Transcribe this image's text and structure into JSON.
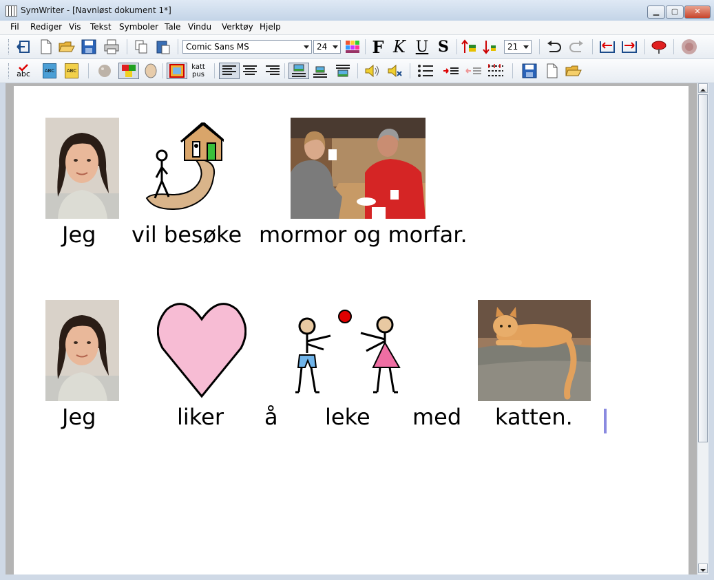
{
  "window": {
    "title": "SymWriter - [Navnløst dokument 1*]",
    "controls": {
      "minimize": "▁",
      "maximize": "▢",
      "close": "✕"
    },
    "mdi_controls": {
      "minimize": "_",
      "restore": "❐",
      "close": "✕"
    }
  },
  "menu": [
    "Fil",
    "Rediger",
    "Vis",
    "Tekst",
    "Symboler",
    "Tale",
    "Vindu",
    "Verktøy",
    "Hjelp"
  ],
  "toolbar": {
    "font_name": "Comic Sans MS",
    "font_size": "24",
    "bold_label": "F",
    "italic_label": "K",
    "underline_label": "U",
    "strike_label": "S",
    "symbol_size": "21",
    "spellcheck_label": "abc",
    "abc_label": "ABC",
    "katt_label_1": "katt",
    "katt_label_2": "pus"
  },
  "icons": [
    "exit-icon",
    "new-document-icon",
    "open-folder-icon",
    "save-icon",
    "print-icon",
    "copy-icon",
    "paste-icon",
    "color-palette-icon",
    "bold-icon",
    "italic-icon",
    "underline-icon",
    "strike-icon",
    "increase-symbol-size-icon",
    "decrease-symbol-size-icon",
    "undo-icon",
    "redo-icon",
    "indent-left-icon",
    "indent-right-icon",
    "stop-icon",
    "record-icon",
    "spellcheck-icon",
    "symbol-set-icon",
    "symbol-set-alt-icon",
    "palette-icon",
    "color-swatch-icon",
    "oval-icon",
    "picture-frame-icon",
    "symbol-label-icon",
    "align-left-icon",
    "align-center-icon",
    "align-right-icon",
    "picture-above-icon",
    "picture-middle-icon",
    "picture-below-icon",
    "speak-icon",
    "speak-settings-icon",
    "bullet-list-icon",
    "outdent-icon",
    "indent-icon",
    "numbered-list-icon",
    "save-small-icon",
    "new-small-icon",
    "open-small-icon"
  ],
  "document": {
    "line1": [
      "Jeg",
      "vil besøke",
      "mormor og morfar."
    ],
    "line2": [
      "Jeg",
      "liker",
      "å",
      "leke",
      "med",
      "katten."
    ]
  },
  "colors": {
    "heart": "#f7bcd4",
    "ball": "#e00000",
    "path": "#d9b48a",
    "house": "#d9a56a",
    "door": "#3bbf3b",
    "caret": "#8a8ae0"
  }
}
